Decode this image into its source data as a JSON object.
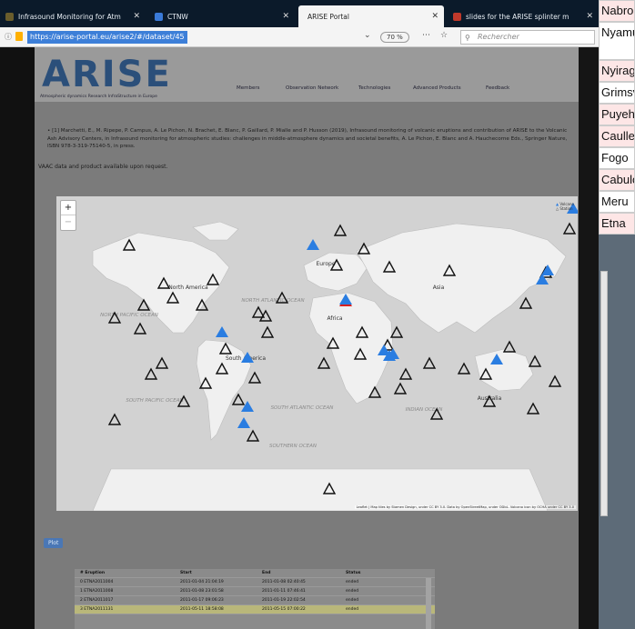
{
  "tabs": [
    {
      "label": "Infrasound Monitoring for Atm"
    },
    {
      "label": "CTNW"
    },
    {
      "label": "ARISE Portal"
    },
    {
      "label": "slides for the ARISE splinter m"
    }
  ],
  "address": {
    "url": "https://arise-portal.eu/arise2/#/dataset/45",
    "zoom": "70 %",
    "search_placeholder": "Rechercher"
  },
  "site": {
    "logo": "ARISE",
    "logo_subtitle": "Atmospheric dynamics Research InfraStructure in Europe",
    "nav": [
      "Members",
      "Observation Network",
      "Technologies",
      "Advanced Products",
      "Feedback"
    ]
  },
  "reference": "[1] Marchetti, E., M. Ripepe, P. Campus, A. Le Pichon, N. Brachet, E. Blanc, P. Gaillard, P. Mialle and P. Husson (2019), Infrasound monitoring of volcanic eruptions and contribution of ARISE to the Volcanic Ash Advisory Centers, in Infrasound monitoring for atmospheric studies: challenges in middle-atmosphere dynamics and societal benefits, A. Le Pichon, E. Blanc and A. Hauchecorne Eds., Springer Nature, ISBN 978-3-319-75140-5, in press.",
  "vaac_note": "VAAC data and product available upon request.",
  "map": {
    "zoom_in": "+",
    "zoom_out": "−",
    "legend": {
      "volcano": "Volcano",
      "station": "Station"
    },
    "continents": [
      "North America",
      "South America",
      "Europe",
      "Africa",
      "Asia",
      "Australia"
    ],
    "oceans": [
      "NORTH PACIFIC OCEAN",
      "NORTH ATLANTIC OCEAN",
      "SOUTH PACIFIC OCEAN",
      "SOUTH ATLANTIC OCEAN",
      "INDIAN OCEAN",
      "SOUTHERN OCEAN"
    ],
    "attribution": "Leaflet | Map tiles by Stamen Design, under CC BY 3.0. Data by OpenStreetMap, under ODbL. Volcano icon by OCHA under CC BY 3.0"
  },
  "plot_button": "Plot",
  "table": {
    "headers": [
      "# Eruption",
      "Start",
      "End",
      "Status"
    ],
    "rows": [
      [
        "0  ETNA2011004",
        "2011-01-04 21:04:19",
        "2011-01-08 02:40:45",
        "ended"
      ],
      [
        "1  ETNA2011008",
        "2011-01-08 23:01:58",
        "2011-01-11 07:46:41",
        "ended"
      ],
      [
        "2  ETNA2011017",
        "2011-01-17 09:06:23",
        "2011-01-19 22:02:54",
        "ended"
      ],
      [
        "3  ETNA2011131",
        "2011-05-11 18:58:08",
        "2011-05-15 07:00:22",
        "ended"
      ]
    ]
  },
  "volcano_list": [
    "Nabro",
    "Nyamu",
    "Nyirag",
    "Grimsv",
    "Puyeh",
    "Caulle",
    "Fogo",
    "Cabulo",
    "Meru",
    "Etna"
  ],
  "colors": {
    "volcano": "#2a7de1",
    "active_volcano": "#d62020",
    "station": "#111111"
  }
}
